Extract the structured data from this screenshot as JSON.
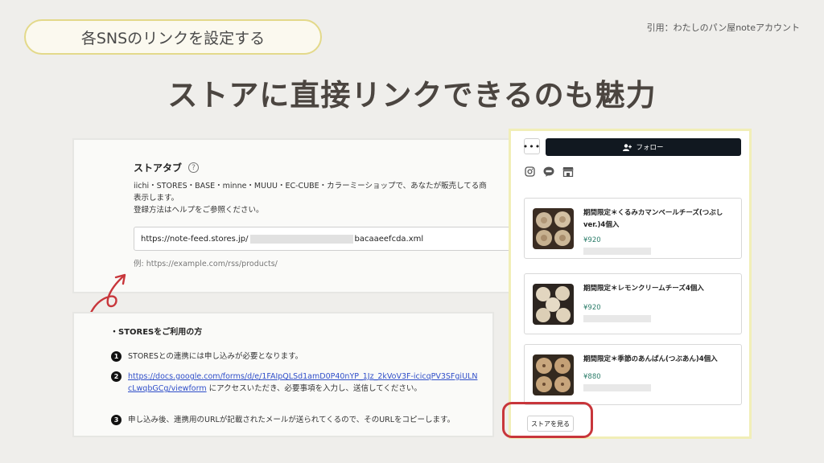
{
  "slide": {
    "pill_label": "各SNSのリンクを設定する",
    "citation": "引用：わたしのパン屋noteアカウント",
    "headline": "ストアに直接リンクできるのも魅力"
  },
  "settings": {
    "title": "ストアタブ",
    "help": "?",
    "description_line1": "iichi・STORES・BASE・minne・MUUU・EC-CUBE・カラーミーショップで、あなたが販売してる商",
    "description_line2": "表示します。",
    "description_line3": "登録方法はヘルプをご参照ください。",
    "url_prefix": "https://note-feed.stores.jp/",
    "url_suffix": "bacaaeefcda.xml",
    "example": "例: https://example.com/rss/products/"
  },
  "instructions": {
    "title": "・STORESをご利用の方",
    "steps": [
      {
        "num": "1",
        "text": "STORESとの連携には申し込みが必要となります。"
      },
      {
        "num": "2",
        "link": "https://docs.google.com/forms/d/e/1FAIpQLSd1amD0P40nYP_1Jz_2kVoV3F-icicqPV3SFgiULNcLwqbGCg/viewform",
        "text": " にアクセスいただき、必要事項を入力し、送信してください。"
      },
      {
        "num": "3",
        "text": "申し込み後、連携用のURLが記載されたメールが送られてくるので、そのURLをコピーします。"
      }
    ]
  },
  "profile": {
    "more": "•••",
    "follow_label": "フォロー",
    "social_icons": [
      "instagram-icon",
      "line-icon",
      "store-icon"
    ],
    "products": [
      {
        "name": "期間限定＊くるみカマンベールチーズ(つぶしver.)4個入",
        "price": "¥920"
      },
      {
        "name": "期間限定＊レモンクリームチーズ4個入",
        "price": "¥920"
      },
      {
        "name": "期間限定＊季節のあんぱん(つぶあん)4個入",
        "price": "¥880"
      }
    ],
    "store_button": "ストアを見る"
  },
  "colors": {
    "accent_red": "#c8363b",
    "pill_border": "#e3d98a",
    "price_green": "#2c7d6a"
  }
}
